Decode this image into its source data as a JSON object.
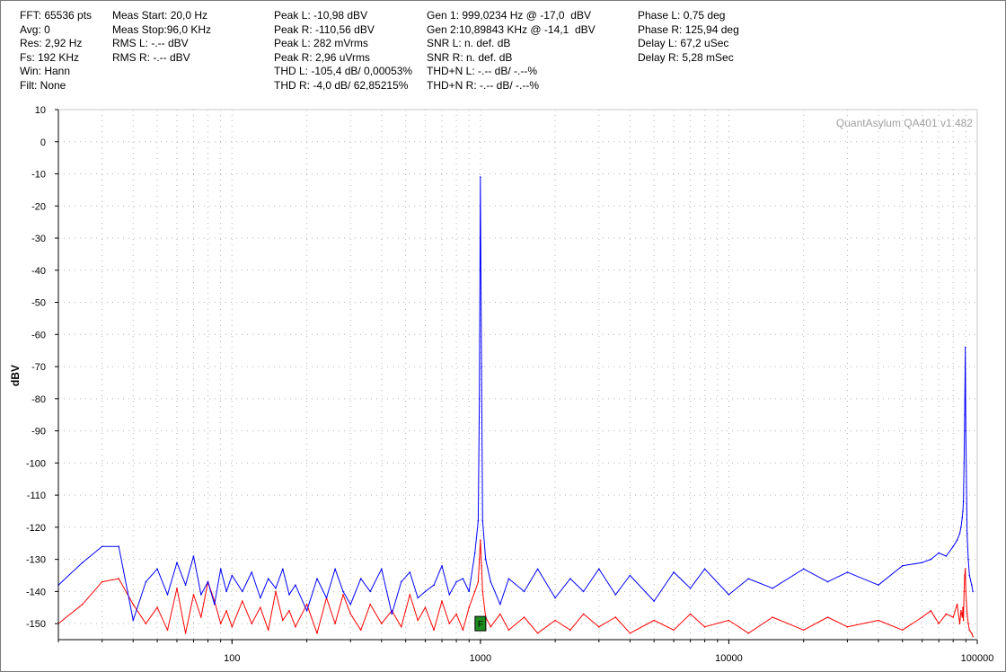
{
  "stats": {
    "col1": [
      "FFT: 65536 pts",
      "Avg: 0",
      "Res: 2,92 Hz",
      "Fs: 192 KHz",
      "Win: Hann",
      "Filt: None"
    ],
    "col2": [
      "Meas Start: 20,0 Hz",
      "Meas Stop:96,0 KHz",
      "RMS L: -.-- dBV",
      "RMS R: -.-- dBV"
    ],
    "col3": [
      "Peak L: -10,98 dBV",
      "Peak R: -110,56 dBV",
      "Peak L: 282 mVrms",
      "Peak R: 2,96 uVrms",
      "THD L: -105,4 dB/ 0,00053%",
      "THD R: -4,0 dB/ 62,85215%"
    ],
    "col4": [
      "Gen 1: 999,0234 Hz @ -17,0  dBV",
      "Gen 2:10,89843 KHz @ -14,1  dBV",
      "SNR L: n. def. dB",
      "SNR R: n. def. dB",
      "THD+N L: -.-- dB/ -.--%",
      "THD+N R: -.-- dB/ -.--%"
    ],
    "col5": [
      "Phase L: 0,75 deg",
      "Phase R: 125,94 deg",
      "Delay L: 67,2 uSec",
      "Delay R: 5,28 mSec"
    ]
  },
  "watermark": "QuantAsylum QA401 v1.482",
  "marker": {
    "label": "F",
    "frequency": 1000,
    "level_dbv": -150
  },
  "colors": {
    "left_channel": "#0000ff",
    "right_channel": "#ff0000",
    "grid": "#b4b4b4",
    "marker_fill": "#1e8c1e"
  },
  "chart_data": {
    "type": "line",
    "title": "",
    "xlabel": "",
    "ylabel": "dBV",
    "x_scale": "log",
    "xlim": [
      20,
      100000
    ],
    "ylim": [
      -155,
      10
    ],
    "x_ticks": [
      100,
      1000,
      10000,
      100000
    ],
    "x_tick_labels": [
      "100",
      "1000",
      "10000",
      "100000"
    ],
    "y_ticks": [
      10,
      0,
      -10,
      -20,
      -30,
      -40,
      -50,
      -60,
      -70,
      -80,
      -90,
      -100,
      -110,
      -120,
      -130,
      -140,
      -150
    ],
    "y_tick_labels": [
      "10",
      "0",
      "-10",
      "-20",
      "-30",
      "-40",
      "-50",
      "-60",
      "-70",
      "-80",
      "-90",
      "-100",
      "-110",
      "-120",
      "-130",
      "-140",
      "-150"
    ],
    "grid": true,
    "series": [
      {
        "channel": "left",
        "x": [
          20,
          25,
          30,
          35,
          40,
          45,
          50,
          55,
          60,
          65,
          70,
          75,
          80,
          85,
          90,
          95,
          100,
          110,
          120,
          130,
          140,
          150,
          160,
          170,
          180,
          200,
          220,
          240,
          260,
          280,
          300,
          330,
          360,
          400,
          440,
          480,
          520,
          560,
          600,
          650,
          700,
          750,
          800,
          850,
          900,
          950,
          980,
          990,
          999,
          1010,
          1020,
          1050,
          1100,
          1200,
          1300,
          1500,
          1700,
          2000,
          2300,
          2600,
          3000,
          3500,
          4000,
          5000,
          6000,
          7000,
          8000,
          10000,
          12000,
          15000,
          20000,
          25000,
          30000,
          40000,
          50000,
          60000,
          65000,
          70000,
          75000,
          80000,
          83000,
          85000,
          86000,
          87000,
          87500,
          88000,
          88500,
          89000,
          89500,
          90000,
          91000,
          92000,
          93000,
          95000,
          96000
        ],
        "y": [
          -138,
          -131,
          -126,
          -126,
          -149,
          -137,
          -133,
          -141,
          -131,
          -138,
          -129,
          -141,
          -137,
          -144,
          -133,
          -140,
          -135,
          -140,
          -134,
          -142,
          -136,
          -139,
          -133,
          -141,
          -138,
          -146,
          -136,
          -142,
          -133,
          -140,
          -144,
          -136,
          -140,
          -133,
          -147,
          -137,
          -134,
          -142,
          -140,
          -138,
          -132,
          -141,
          -137,
          -136,
          -140,
          -128,
          -118,
          -80,
          -11,
          -70,
          -118,
          -130,
          -137,
          -144,
          -136,
          -140,
          -133,
          -142,
          -136,
          -140,
          -133,
          -141,
          -135,
          -143,
          -134,
          -139,
          -133,
          -141,
          -136,
          -139,
          -133,
          -137,
          -134,
          -138,
          -132,
          -131,
          -130,
          -128,
          -129,
          -126,
          -124,
          -122,
          -120,
          -117,
          -115,
          -112,
          -100,
          -85,
          -64,
          -90,
          -122,
          -130,
          -135,
          -138,
          -140
        ]
      },
      {
        "channel": "right",
        "x": [
          20,
          25,
          30,
          35,
          40,
          45,
          50,
          55,
          60,
          65,
          70,
          75,
          80,
          85,
          90,
          95,
          100,
          110,
          120,
          130,
          140,
          150,
          160,
          170,
          180,
          200,
          220,
          240,
          260,
          280,
          300,
          330,
          360,
          400,
          440,
          480,
          520,
          560,
          600,
          650,
          700,
          750,
          800,
          850,
          900,
          950,
          980,
          990,
          999,
          1010,
          1020,
          1050,
          1100,
          1200,
          1300,
          1500,
          1700,
          2000,
          2300,
          2600,
          3000,
          3500,
          4000,
          5000,
          6000,
          7000,
          8000,
          10000,
          12000,
          15000,
          20000,
          25000,
          30000,
          40000,
          50000,
          60000,
          65000,
          70000,
          75000,
          80000,
          83000,
          85000,
          86000,
          87000,
          87500,
          88000,
          88500,
          89000,
          89500,
          90000,
          91000,
          92000,
          93000,
          95000,
          96000
        ],
        "y": [
          -150,
          -144,
          -137,
          -136,
          -144,
          -150,
          -145,
          -152,
          -139,
          -153,
          -141,
          -148,
          -137,
          -143,
          -150,
          -146,
          -151,
          -143,
          -150,
          -145,
          -152,
          -140,
          -149,
          -146,
          -151,
          -144,
          -153,
          -142,
          -150,
          -141,
          -147,
          -152,
          -144,
          -150,
          -146,
          -151,
          -141,
          -149,
          -145,
          -152,
          -143,
          -150,
          -147,
          -152,
          -145,
          -140,
          -137,
          -130,
          -124,
          -132,
          -140,
          -148,
          -151,
          -147,
          -152,
          -148,
          -153,
          -149,
          -152,
          -147,
          -151,
          -148,
          -153,
          -149,
          -152,
          -147,
          -151,
          -149,
          -153,
          -148,
          -152,
          -148,
          -151,
          -149,
          -152,
          -148,
          -146,
          -150,
          -147,
          -148,
          -144,
          -150,
          -146,
          -148,
          -145,
          -149,
          -140,
          -135,
          -133,
          -140,
          -147,
          -150,
          -152,
          -153,
          -154
        ]
      }
    ]
  }
}
